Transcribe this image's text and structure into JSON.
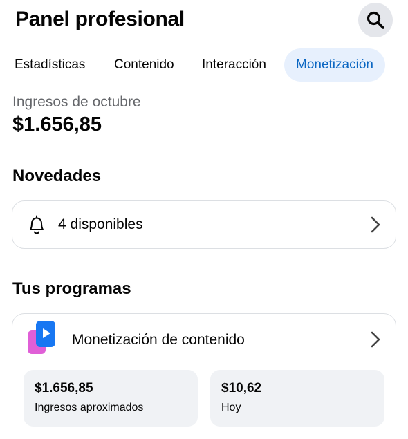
{
  "header": {
    "title": "Panel profesional",
    "search_icon": "search-icon"
  },
  "tabs": [
    {
      "label": "Estadísticas",
      "active": false
    },
    {
      "label": "Contenido",
      "active": false
    },
    {
      "label": "Interacción",
      "active": false
    },
    {
      "label": "Monetización",
      "active": true
    }
  ],
  "earnings": {
    "label": "Ingresos de octubre",
    "value": "$1.656,85"
  },
  "news": {
    "section_title": "Novedades",
    "text": "4 disponibles",
    "icon": "bell-icon"
  },
  "programs": {
    "section_title": "Tus programas",
    "items": [
      {
        "title": "Monetización de contenido",
        "icon": "content-monetization-icon",
        "stats": [
          {
            "value": "$1.656,85",
            "label": "Ingresos aproximados"
          },
          {
            "value": "$10,62",
            "label": "Hoy"
          }
        ]
      }
    ]
  },
  "colors": {
    "accent": "#0a66c2",
    "active_tab_bg": "#e7f0fd",
    "muted_text": "#65676b",
    "tile_bg": "#f0f2f5",
    "search_bg": "#e4e6eb"
  }
}
